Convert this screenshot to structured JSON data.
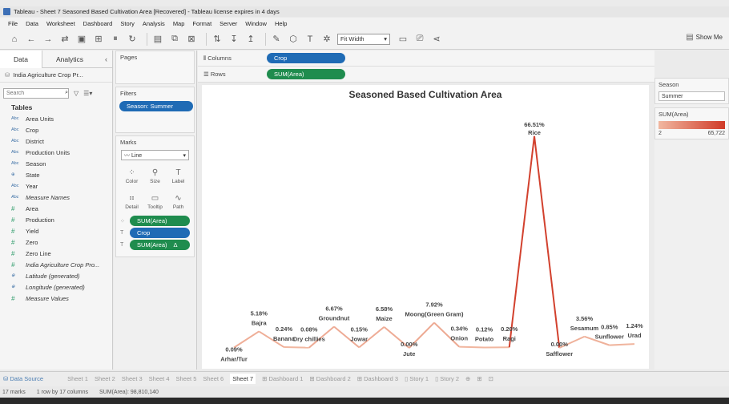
{
  "window": {
    "title": "Tableau - Sheet 7 Seasoned Based Cultivation Area [Recovered] - Tableau license expires in 4 days"
  },
  "menu": [
    "File",
    "Data",
    "Worksheet",
    "Dashboard",
    "Story",
    "Analysis",
    "Map",
    "Format",
    "Server",
    "Window",
    "Help"
  ],
  "toolbar": {
    "fit": "Fit Width",
    "show_me": "Show Me",
    "icons": [
      "home-icon",
      "back-icon",
      "forward-icon",
      "connect-icon",
      "save-icon",
      "new-datasource-icon",
      "pause-icon",
      "refresh-icon",
      "new-sheet-icon",
      "duplicate-icon",
      "clear-icon",
      "swap-icon",
      "sort-asc-icon",
      "sort-desc-icon",
      "highlight-icon",
      "group-icon",
      "labels-icon",
      "pin-icon",
      "presentation-icon",
      "share-icon"
    ]
  },
  "datapane": {
    "tabs": [
      "Data",
      "Analytics"
    ],
    "datasource": "India Agriculture Crop Pr...",
    "search_placeholder": "Search",
    "tables_heading": "Tables",
    "fields": [
      {
        "type": "Abc",
        "name": "Area Units"
      },
      {
        "type": "Abc",
        "name": "Crop"
      },
      {
        "type": "Abc",
        "name": "District"
      },
      {
        "type": "Abc",
        "name": "Production Units"
      },
      {
        "type": "Abc",
        "name": "Season"
      },
      {
        "type": "geo",
        "name": "State"
      },
      {
        "type": "Abc",
        "name": "Year"
      },
      {
        "type": "Abc",
        "name": "Measure Names",
        "italic": true
      },
      {
        "type": "#",
        "name": "Area"
      },
      {
        "type": "#",
        "name": "Production"
      },
      {
        "type": "#",
        "name": "Yield"
      },
      {
        "type": "#",
        "name": "Zero"
      },
      {
        "type": "#",
        "name": "Zero Line"
      },
      {
        "type": "#",
        "name": "India Agriculture Crop Pro...",
        "italic": true
      },
      {
        "type": "geo",
        "name": "Latitude (generated)",
        "italic": true
      },
      {
        "type": "geo",
        "name": "Longitude (generated)",
        "italic": true
      },
      {
        "type": "#",
        "name": "Measure Values",
        "italic": true
      }
    ]
  },
  "pages": {
    "title": "Pages"
  },
  "filters": {
    "title": "Filters",
    "pill": "Season: Summer"
  },
  "marks": {
    "title": "Marks",
    "type": "Line",
    "buttons": [
      "Color",
      "Size",
      "Label",
      "Detail",
      "Tooltip",
      "Path"
    ],
    "pills": [
      {
        "label": "SUM(Area)",
        "color": "green"
      },
      {
        "label": "Crop",
        "color": "blue"
      },
      {
        "label": "SUM(Area)",
        "color": "green",
        "suffix": "Δ"
      }
    ]
  },
  "shelves": {
    "columns_label": "Columns",
    "columns_pill": "Crop",
    "rows_label": "Rows",
    "rows_pill": "SUM(Area)"
  },
  "legend": {
    "season_title": "Season",
    "season_value": "Summer",
    "color_title": "SUM(Area)",
    "min": "2",
    "max": "65,722",
    "color_low": "#f1b7a0",
    "color_high": "#d03b28"
  },
  "chart_data": {
    "type": "line",
    "title": "Seasoned Based Cultivation Area",
    "categories": [
      "Arhar/Tur",
      "Bajra",
      "Banana",
      "Dry chillies",
      "Groundnut",
      "Jowar",
      "Maize",
      "Jute",
      "Moong(Green Gram)",
      "Onion",
      "Potato",
      "Ragi",
      "Rice",
      "Safflower",
      "Sesamum",
      "Sunflower",
      "Urad"
    ],
    "series": [
      {
        "values": [
          0.09,
          5.18,
          0.24,
          0.08,
          6.67,
          0.15,
          6.58,
          0.0,
          7.92,
          0.34,
          0.12,
          0.2,
          66.51,
          0.0,
          3.56,
          0.85,
          1.24
        ]
      }
    ],
    "labels": [
      "0.09%",
      "5.18%",
      "0.24%",
      "0.08%",
      "6.67%",
      "0.15%",
      "6.58%",
      "0.00%",
      "7.92%",
      "0.34%",
      "0.12%",
      "0.20%",
      "66.51%",
      "0.00%",
      "3.56%",
      "0.85%",
      "1.24%"
    ],
    "xlabel": "",
    "ylabel": "",
    "ylim": [
      0,
      70
    ],
    "grid": false,
    "axes_visible": false
  },
  "sheet_tabs": [
    "Data Source",
    "Sheet 1",
    "Sheet 2",
    "Sheet 3",
    "Sheet 4",
    "Sheet 5",
    "Sheet 6",
    "Sheet 7",
    "Dashboard 1",
    "Dashboard 2",
    "Dashboard 3",
    "Story 1",
    "Story 2"
  ],
  "active_sheet": "Sheet 7",
  "status": {
    "marks": "17 marks",
    "rows": "1 row by 17 columns",
    "sum": "SUM(Area): 98,810,140"
  }
}
